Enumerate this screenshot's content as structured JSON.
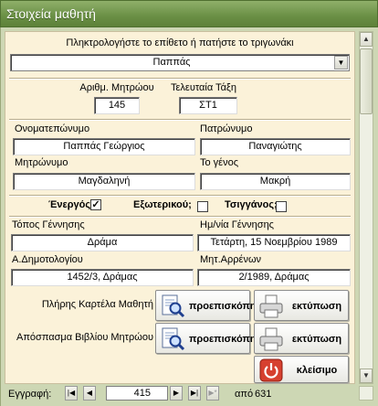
{
  "window": {
    "title": "Στοιχεία μαθητή"
  },
  "search": {
    "prompt": "Πληκτρολογήστε το επίθετο ή πατήστε το τριγωνάκι",
    "selected": "Παππάς"
  },
  "registry": {
    "number_label": "Αριθμ. Μητρώου",
    "number": "145",
    "last_class_label": "Τελευταία Τάξη",
    "last_class": "ΣΤ1"
  },
  "person": {
    "fullname_label": "Ονοματεπώνυμο",
    "fullname": "Παππάς  Γεώργιος",
    "father_label": "Πατρώνυμο",
    "father": "Παναγιώτης",
    "mother_label": "Μητρώνυμο",
    "mother": "Μαγδαληνή",
    "mother_surname_label": "Το γένος",
    "mother_surname": "Μακρή"
  },
  "flags": {
    "active_label": "Ένεργός",
    "active": "✓",
    "external_label": "Εξωτερικού;",
    "external": "",
    "gypsy_label": "Τσιγγάνος;",
    "gypsy": ""
  },
  "birth": {
    "place_label": "Τόπος Γέννησης",
    "place": "Δράμα",
    "date_label": "Ημ/νία Γέννησης",
    "date": "Τετάρτη, 15 Νοεμβρίου 1989",
    "municipal_label": "Α.Δημοτολογίου",
    "municipal": "1452/3, Δράμας",
    "male_reg_label": "Μητ.Αρρένων",
    "male_reg": "2/1989, Δράμας"
  },
  "actions": {
    "card_label": "Πλήρης Καρτέλα Μαθητή",
    "excerpt_label": "Απόσπασμα Βιβλίου Μητρώου",
    "preview": "προεπισκόπηση",
    "print": "εκτύπωση",
    "close": "κλείσιμο"
  },
  "navigation": {
    "record_label": "Εγγραφή:",
    "current": "415",
    "of_label": "από",
    "total": "631"
  }
}
